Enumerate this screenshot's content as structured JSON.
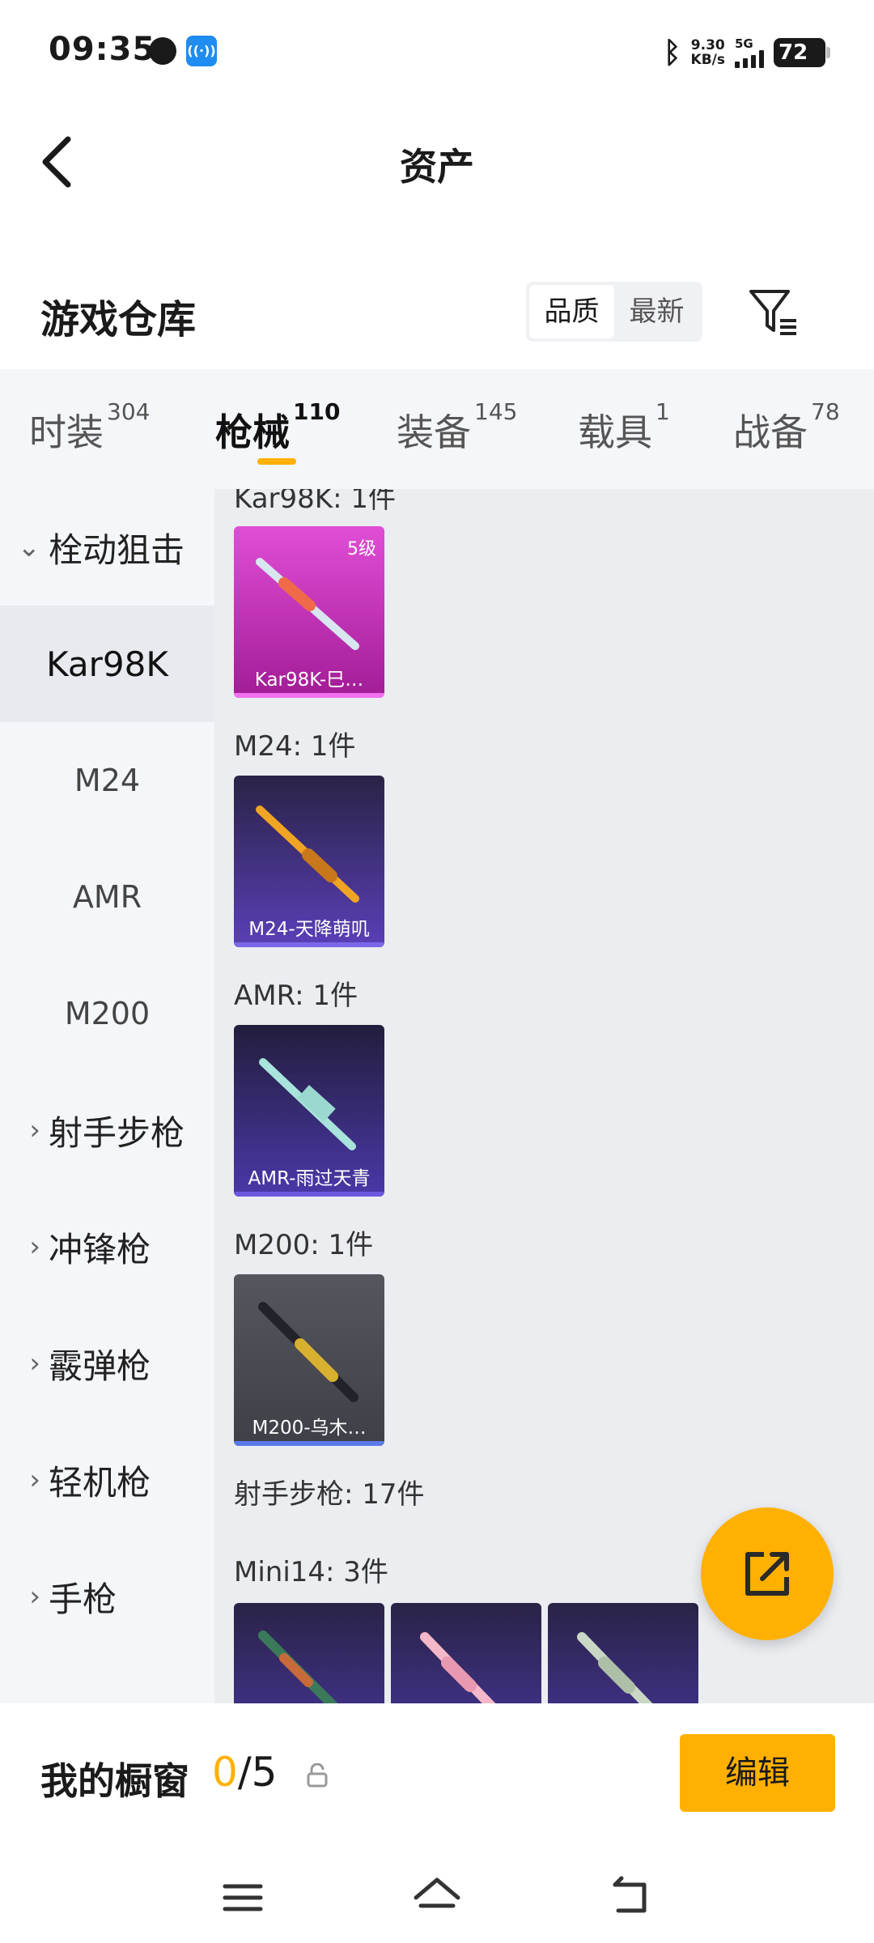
{
  "status": {
    "time": "09:35",
    "speed_value": "9.30",
    "speed_unit": "KB/s",
    "network": "5G",
    "battery": "72"
  },
  "header": {
    "title": "资产"
  },
  "warehouse": {
    "title": "游戏仓库",
    "sort_quality": "品质",
    "sort_newest": "最新"
  },
  "tabs": [
    {
      "label": "时装",
      "count": "304"
    },
    {
      "label": "枪械",
      "count": "110"
    },
    {
      "label": "装备",
      "count": "145"
    },
    {
      "label": "载具",
      "count": "1"
    },
    {
      "label": "战备",
      "count": "78"
    }
  ],
  "sidebar": {
    "items": [
      {
        "label": "栓动狙击"
      },
      {
        "label": "Kar98K"
      },
      {
        "label": "M24"
      },
      {
        "label": "AMR"
      },
      {
        "label": "M200"
      },
      {
        "label": "射手步枪"
      },
      {
        "label": "冲锋枪"
      },
      {
        "label": "霰弹枪"
      },
      {
        "label": "轻机枪"
      },
      {
        "label": "手枪"
      }
    ]
  },
  "content": {
    "top_cut_label": "Kar98K: 1件",
    "groups": [
      {
        "label": "M24: 1件"
      },
      {
        "label": "AMR: 1件"
      },
      {
        "label": "M200: 1件"
      },
      {
        "label": "射手步枪: 17件"
      },
      {
        "label": "Mini14: 3件"
      }
    ],
    "cards": [
      {
        "name": "Kar98K-巳…",
        "level": "5级",
        "color": "#d23cc8"
      },
      {
        "name": "M24-天降萌叽",
        "color": "#5a3fb8"
      },
      {
        "name": "AMR-雨过天青",
        "color": "#4a38a8"
      },
      {
        "name": "M200-乌木…",
        "color": "#4a4b55"
      }
    ]
  },
  "showcase": {
    "title": "我的橱窗",
    "current": "0",
    "total": "/5",
    "edit_label": "编辑"
  },
  "colors": {
    "accent": "#ffb000",
    "background": "#ebedf1"
  }
}
